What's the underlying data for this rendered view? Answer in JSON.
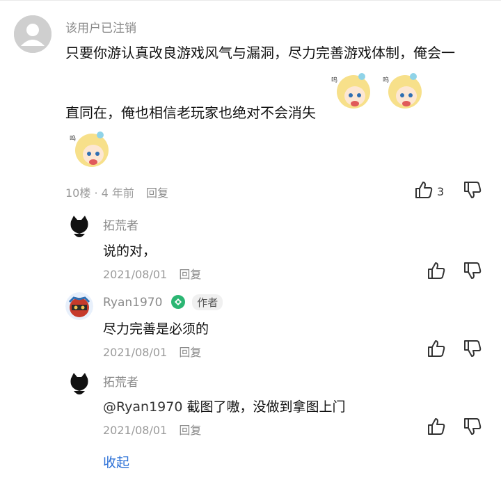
{
  "main_comment": {
    "username": "该用户已注销",
    "line1": "只要你游认真改良游戏风气与漏洞，尽力完善游戏体制，俺会一",
    "line2": "直同在，俺也相信老玩家也绝对不会消失",
    "floor": "10楼",
    "time": "4 年前",
    "reply_label": "回复",
    "like_count": "3",
    "avatar_icon": "default-user-avatar-icon",
    "sticker_icon": "anime-girl-sticker"
  },
  "replies": [
    {
      "username": "拓荒者",
      "text": "说的对，",
      "date": "2021/08/01",
      "reply_label": "回复",
      "avatar_icon": "black-cat-avatar-icon"
    },
    {
      "username": "Ryan1970",
      "author_tag": "作者",
      "text": "尽力完善是必须的",
      "date": "2021/08/01",
      "reply_label": "回复",
      "avatar_icon": "helmet-avatar-icon",
      "badge_icon": "green-badge-icon"
    },
    {
      "username": "拓荒者",
      "mention": "@Ryan1970",
      "text": " 截图了嗷，没做到拿图上门",
      "date": "2021/08/01",
      "reply_label": "回复",
      "avatar_icon": "black-cat-avatar-icon"
    }
  ],
  "collapse_label": "收起"
}
